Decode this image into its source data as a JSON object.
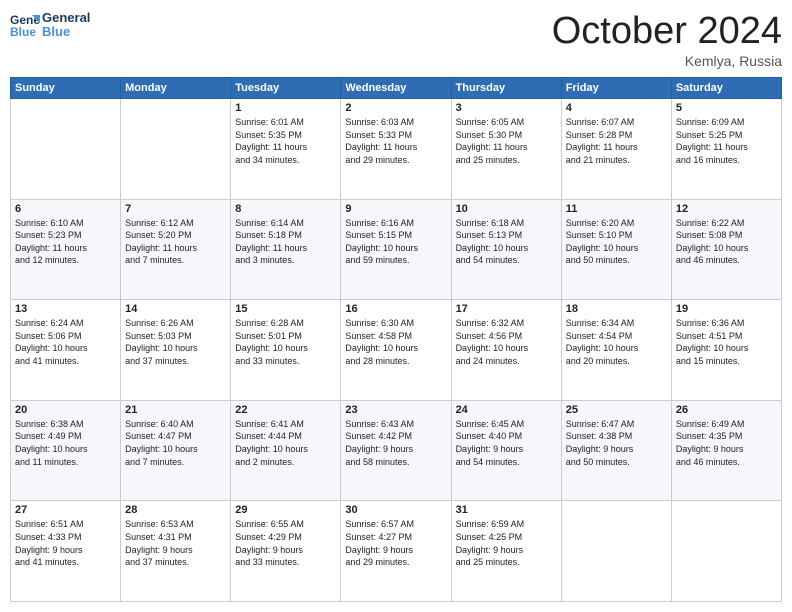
{
  "logo": {
    "line1": "General",
    "line2": "Blue"
  },
  "title": "October 2024",
  "subtitle": "Kemlya, Russia",
  "days_header": [
    "Sunday",
    "Monday",
    "Tuesday",
    "Wednesday",
    "Thursday",
    "Friday",
    "Saturday"
  ],
  "weeks": [
    [
      {
        "day": "",
        "info": ""
      },
      {
        "day": "",
        "info": ""
      },
      {
        "day": "1",
        "info": "Sunrise: 6:01 AM\nSunset: 5:35 PM\nDaylight: 11 hours\nand 34 minutes."
      },
      {
        "day": "2",
        "info": "Sunrise: 6:03 AM\nSunset: 5:33 PM\nDaylight: 11 hours\nand 29 minutes."
      },
      {
        "day": "3",
        "info": "Sunrise: 6:05 AM\nSunset: 5:30 PM\nDaylight: 11 hours\nand 25 minutes."
      },
      {
        "day": "4",
        "info": "Sunrise: 6:07 AM\nSunset: 5:28 PM\nDaylight: 11 hours\nand 21 minutes."
      },
      {
        "day": "5",
        "info": "Sunrise: 6:09 AM\nSunset: 5:25 PM\nDaylight: 11 hours\nand 16 minutes."
      }
    ],
    [
      {
        "day": "6",
        "info": "Sunrise: 6:10 AM\nSunset: 5:23 PM\nDaylight: 11 hours\nand 12 minutes."
      },
      {
        "day": "7",
        "info": "Sunrise: 6:12 AM\nSunset: 5:20 PM\nDaylight: 11 hours\nand 7 minutes."
      },
      {
        "day": "8",
        "info": "Sunrise: 6:14 AM\nSunset: 5:18 PM\nDaylight: 11 hours\nand 3 minutes."
      },
      {
        "day": "9",
        "info": "Sunrise: 6:16 AM\nSunset: 5:15 PM\nDaylight: 10 hours\nand 59 minutes."
      },
      {
        "day": "10",
        "info": "Sunrise: 6:18 AM\nSunset: 5:13 PM\nDaylight: 10 hours\nand 54 minutes."
      },
      {
        "day": "11",
        "info": "Sunrise: 6:20 AM\nSunset: 5:10 PM\nDaylight: 10 hours\nand 50 minutes."
      },
      {
        "day": "12",
        "info": "Sunrise: 6:22 AM\nSunset: 5:08 PM\nDaylight: 10 hours\nand 46 minutes."
      }
    ],
    [
      {
        "day": "13",
        "info": "Sunrise: 6:24 AM\nSunset: 5:06 PM\nDaylight: 10 hours\nand 41 minutes."
      },
      {
        "day": "14",
        "info": "Sunrise: 6:26 AM\nSunset: 5:03 PM\nDaylight: 10 hours\nand 37 minutes."
      },
      {
        "day": "15",
        "info": "Sunrise: 6:28 AM\nSunset: 5:01 PM\nDaylight: 10 hours\nand 33 minutes."
      },
      {
        "day": "16",
        "info": "Sunrise: 6:30 AM\nSunset: 4:58 PM\nDaylight: 10 hours\nand 28 minutes."
      },
      {
        "day": "17",
        "info": "Sunrise: 6:32 AM\nSunset: 4:56 PM\nDaylight: 10 hours\nand 24 minutes."
      },
      {
        "day": "18",
        "info": "Sunrise: 6:34 AM\nSunset: 4:54 PM\nDaylight: 10 hours\nand 20 minutes."
      },
      {
        "day": "19",
        "info": "Sunrise: 6:36 AM\nSunset: 4:51 PM\nDaylight: 10 hours\nand 15 minutes."
      }
    ],
    [
      {
        "day": "20",
        "info": "Sunrise: 6:38 AM\nSunset: 4:49 PM\nDaylight: 10 hours\nand 11 minutes."
      },
      {
        "day": "21",
        "info": "Sunrise: 6:40 AM\nSunset: 4:47 PM\nDaylight: 10 hours\nand 7 minutes."
      },
      {
        "day": "22",
        "info": "Sunrise: 6:41 AM\nSunset: 4:44 PM\nDaylight: 10 hours\nand 2 minutes."
      },
      {
        "day": "23",
        "info": "Sunrise: 6:43 AM\nSunset: 4:42 PM\nDaylight: 9 hours\nand 58 minutes."
      },
      {
        "day": "24",
        "info": "Sunrise: 6:45 AM\nSunset: 4:40 PM\nDaylight: 9 hours\nand 54 minutes."
      },
      {
        "day": "25",
        "info": "Sunrise: 6:47 AM\nSunset: 4:38 PM\nDaylight: 9 hours\nand 50 minutes."
      },
      {
        "day": "26",
        "info": "Sunrise: 6:49 AM\nSunset: 4:35 PM\nDaylight: 9 hours\nand 46 minutes."
      }
    ],
    [
      {
        "day": "27",
        "info": "Sunrise: 6:51 AM\nSunset: 4:33 PM\nDaylight: 9 hours\nand 41 minutes."
      },
      {
        "day": "28",
        "info": "Sunrise: 6:53 AM\nSunset: 4:31 PM\nDaylight: 9 hours\nand 37 minutes."
      },
      {
        "day": "29",
        "info": "Sunrise: 6:55 AM\nSunset: 4:29 PM\nDaylight: 9 hours\nand 33 minutes."
      },
      {
        "day": "30",
        "info": "Sunrise: 6:57 AM\nSunset: 4:27 PM\nDaylight: 9 hours\nand 29 minutes."
      },
      {
        "day": "31",
        "info": "Sunrise: 6:59 AM\nSunset: 4:25 PM\nDaylight: 9 hours\nand 25 minutes."
      },
      {
        "day": "",
        "info": ""
      },
      {
        "day": "",
        "info": ""
      }
    ]
  ]
}
